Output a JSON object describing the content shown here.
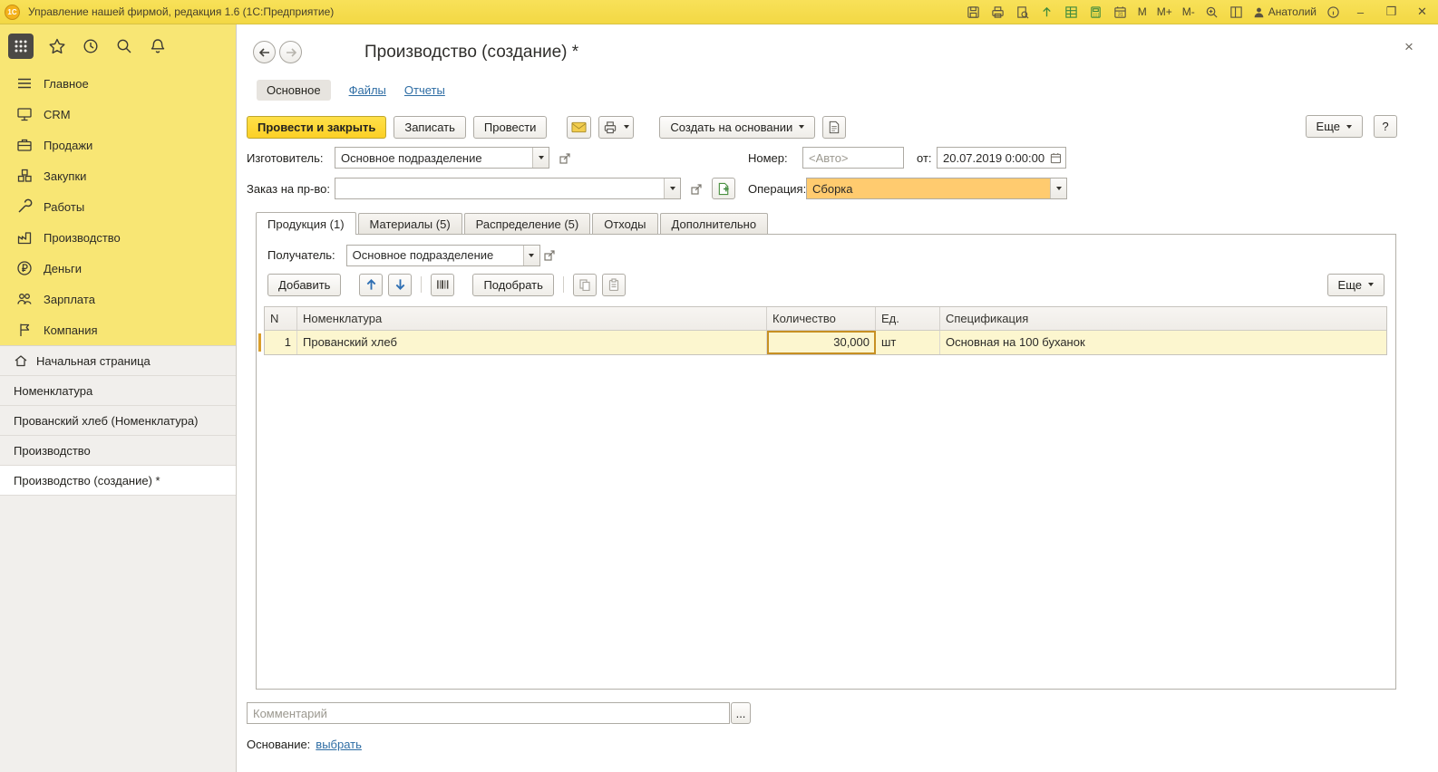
{
  "titlebar": {
    "title": "Управление нашей фирмой, редакция 1.6 (1С:Предприятие)",
    "font_buttons": [
      "M",
      "M+",
      "M-"
    ],
    "user": "Анатолий"
  },
  "sidebar": {
    "menu": [
      {
        "label": "Главное"
      },
      {
        "label": "CRM"
      },
      {
        "label": "Продажи"
      },
      {
        "label": "Закупки"
      },
      {
        "label": "Работы"
      },
      {
        "label": "Производство"
      },
      {
        "label": "Деньги"
      },
      {
        "label": "Зарплата"
      },
      {
        "label": "Компания"
      }
    ],
    "nav": [
      {
        "label": "Начальная страница"
      },
      {
        "label": "Номенклатура"
      },
      {
        "label": "Прованский хлеб (Номенклатура)"
      },
      {
        "label": "Производство"
      },
      {
        "label": "Производство (создание) *"
      }
    ]
  },
  "page": {
    "title": "Производство (создание) *",
    "close": "×",
    "tabs": [
      {
        "label": "Основное"
      },
      {
        "label": "Файлы"
      },
      {
        "label": "Отчеты"
      }
    ],
    "commands": {
      "post_close": "Провести и закрыть",
      "write": "Записать",
      "post": "Провести",
      "create_on_basis": "Создать на основании",
      "more": "Еще",
      "help": "?"
    },
    "fields": {
      "manufacturer": {
        "label": "Изготовитель:",
        "value": "Основное подразделение"
      },
      "number": {
        "label": "Номер:",
        "placeholder": "<Авто>"
      },
      "date": {
        "label": "от:",
        "value": "20.07.2019 0:00:00"
      },
      "order": {
        "label": "Заказ на пр-во:",
        "value": ""
      },
      "operation": {
        "label": "Операция:",
        "value": "Сборка"
      }
    },
    "doc_tabs": [
      {
        "label": "Продукция (1)"
      },
      {
        "label": "Материалы (5)"
      },
      {
        "label": "Распределение (5)"
      },
      {
        "label": "Отходы"
      },
      {
        "label": "Дополнительно"
      }
    ],
    "products": {
      "recipient": {
        "label": "Получатель:",
        "value": "Основное подразделение"
      },
      "toolbar": {
        "add": "Добавить",
        "pick": "Подобрать",
        "more": "Еще"
      },
      "table": {
        "columns": [
          "N",
          "Номенклатура",
          "Количество",
          "Ед.",
          "Спецификация"
        ],
        "rows": [
          {
            "n": "1",
            "name": "Прованский хлеб",
            "qty": "30,000",
            "unit": "шт",
            "spec": "Основная на 100 буханок"
          }
        ]
      }
    },
    "comment": {
      "placeholder": "Комментарий",
      "ellipsis": "..."
    },
    "basis": {
      "label": "Основание:",
      "link": "выбрать"
    }
  }
}
